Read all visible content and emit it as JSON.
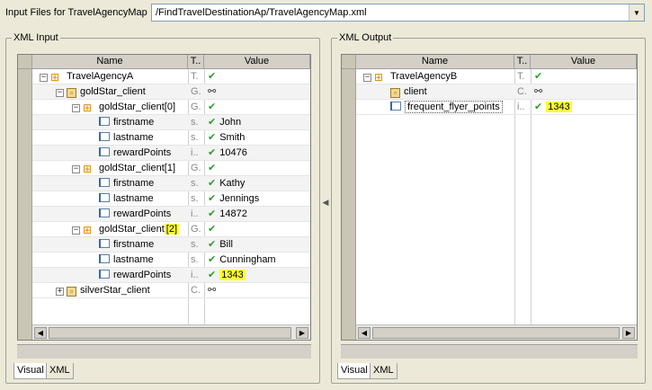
{
  "header": {
    "input_files_label": "Input Files for TravelAgencyMap",
    "file_path": "/FindTravelDestinationAp/TravelAgencyMap.xml"
  },
  "input_panel": {
    "title": "XML Input",
    "columns": {
      "name": "Name",
      "type": "T..",
      "value": "Value"
    },
    "rows": [
      {
        "name": "TravelAgencyA",
        "type": "T.",
        "value": "",
        "check": true
      },
      {
        "name": "goldStar_client",
        "type": "G.",
        "value": "",
        "link": true
      },
      {
        "name": "goldStar_client[0]",
        "type": "G.",
        "value": "",
        "check": true
      },
      {
        "name": "firstname",
        "type": "s.",
        "value": "John",
        "check": true
      },
      {
        "name": "lastname",
        "type": "s.",
        "value": "Smith",
        "check": true
      },
      {
        "name": "rewardPoints",
        "type": "i..",
        "value": "10476",
        "check": true
      },
      {
        "name": "goldStar_client[1]",
        "type": "G.",
        "value": "",
        "check": true
      },
      {
        "name": "firstname",
        "type": "s.",
        "value": "Kathy",
        "check": true
      },
      {
        "name": "lastname",
        "type": "s.",
        "value": "Jennings",
        "check": true
      },
      {
        "name": "rewardPoints",
        "type": "i..",
        "value": "14872",
        "check": true
      },
      {
        "name": "goldStar_client",
        "name_hl": "[2]",
        "type": "G.",
        "value": "",
        "check": true
      },
      {
        "name": "firstname",
        "type": "s.",
        "value": "Bill",
        "check": true
      },
      {
        "name": "lastname",
        "type": "s.",
        "value": "Cunningham",
        "check": true
      },
      {
        "name": "rewardPoints",
        "type": "i..",
        "value": "1343",
        "check": true,
        "value_hl": true
      },
      {
        "name": "silverStar_client",
        "type": "C.",
        "value": "",
        "link": true
      }
    ],
    "tabs": [
      "Visual",
      "XML"
    ]
  },
  "output_panel": {
    "title": "XML Output",
    "columns": {
      "name": "Name",
      "type": "T..",
      "value": "Value"
    },
    "rows": [
      {
        "name": "TravelAgencyB",
        "type": "T.",
        "value": "",
        "check": true
      },
      {
        "name": "client",
        "type": "C.",
        "value": "",
        "link": true
      },
      {
        "name": "frequent_flyer_points",
        "type": "i..",
        "value": "1343",
        "check": true,
        "value_hl": true
      }
    ],
    "tabs": [
      "Visual",
      "XML"
    ]
  },
  "icons": {
    "check": "✔",
    "link": "⚯",
    "dropdown": "▼",
    "collapse": "−",
    "expand": "+",
    "scroll_left": "◀",
    "scroll_right": "▶",
    "splitter": "◀"
  },
  "colors": {
    "highlight": "#ffff33",
    "check": "#2a9d2a"
  }
}
